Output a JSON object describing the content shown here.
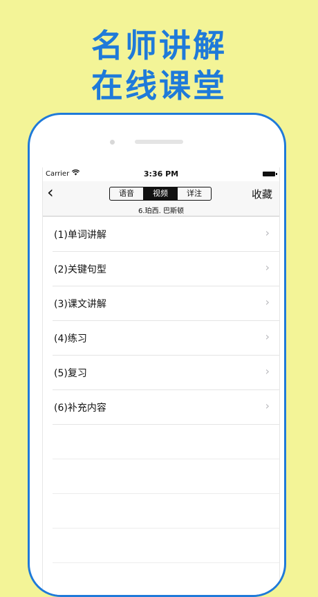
{
  "promo": {
    "line1": "名师讲解",
    "line2": "在线课堂"
  },
  "status_bar": {
    "carrier": "Carrier",
    "wifi_icon": "wifi-icon",
    "time": "3:36 PM",
    "battery_icon": "battery-icon"
  },
  "nav": {
    "back_glyph": "‹",
    "tabs": [
      {
        "label": "语音",
        "active": false
      },
      {
        "label": "视频",
        "active": true
      },
      {
        "label": "详注",
        "active": false
      }
    ],
    "favorite_label": "收藏",
    "subtitle": "6.珀西. 巴斯顿"
  },
  "items": [
    {
      "label": "(1)单词讲解"
    },
    {
      "label": "(2)关键句型"
    },
    {
      "label": "(3)课文讲解"
    },
    {
      "label": "(4)练习"
    },
    {
      "label": "(5)复习"
    },
    {
      "label": "(6)补充内容"
    }
  ],
  "chevron_glyph": "›",
  "colors": {
    "background": "#f3f497",
    "accent": "#1f7ad9"
  }
}
